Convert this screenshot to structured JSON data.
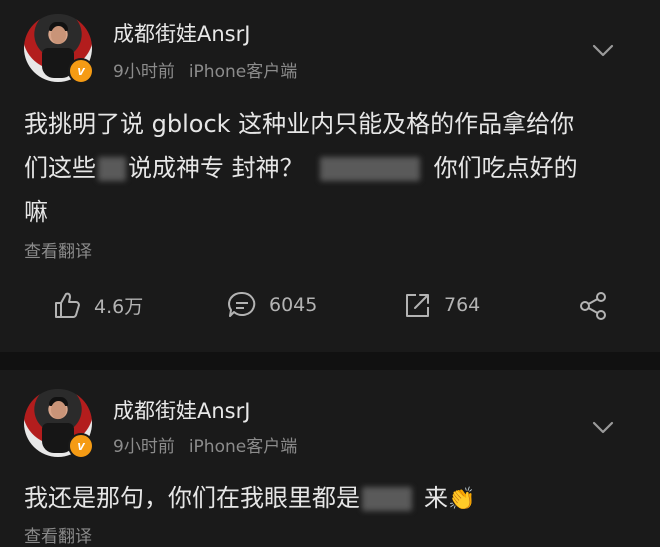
{
  "posts": [
    {
      "username": "成都街娃AnsrJ",
      "time": "9小时前",
      "source": "iPhone客户端",
      "content": {
        "line1": "我挑明了说 gblock 这种业内只能及格的作品拿给你",
        "line2_a": "们这些",
        "line2_b": "说成神专 封神？",
        "line2_c": "你们吃点好的",
        "line3": "嘛"
      },
      "translate_label": "查看翻译",
      "actions": {
        "likes": "4.6万",
        "comments": "6045",
        "reposts": "764"
      }
    },
    {
      "username": "成都街娃AnsrJ",
      "time": "9小时前",
      "source": "iPhone客户端",
      "content": {
        "line1_a": "我还是那句，你们在我眼里都是",
        "line1_b": "来",
        "emoji": "👏"
      },
      "translate_label": "查看翻译"
    }
  ],
  "icons": [
    "like-icon",
    "comment-icon",
    "repost-icon",
    "share-icon",
    "chevron-down-icon",
    "verified-badge-icon"
  ]
}
